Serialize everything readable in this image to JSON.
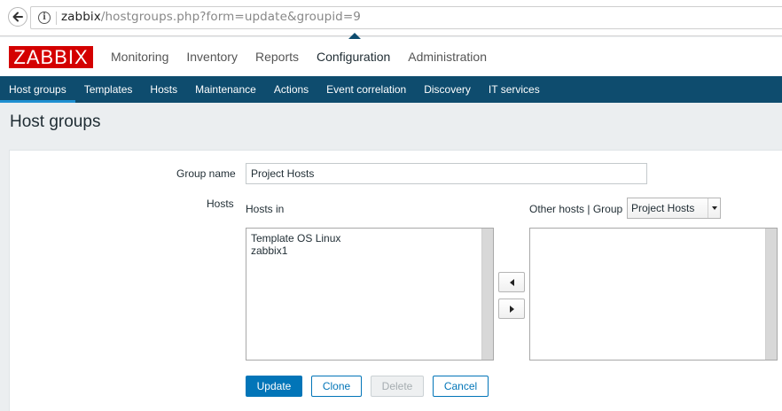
{
  "browser": {
    "url_host": "zabbix",
    "url_path": "/hostgroups.php?form=update&groupid=9"
  },
  "header": {
    "logo": "ZABBIX",
    "nav": [
      "Monitoring",
      "Inventory",
      "Reports",
      "Configuration",
      "Administration"
    ],
    "active_nav": "Configuration"
  },
  "subnav": {
    "items": [
      "Host groups",
      "Templates",
      "Hosts",
      "Maintenance",
      "Actions",
      "Event correlation",
      "Discovery",
      "IT services"
    ],
    "active": "Host groups"
  },
  "page": {
    "title": "Host groups"
  },
  "form": {
    "group_name_label": "Group name",
    "group_name_value": "Project Hosts",
    "hosts_label": "Hosts",
    "hosts_in_label": "Hosts in",
    "other_hosts_label": "Other hosts | Group",
    "group_select_value": "Project Hosts",
    "hosts_in": [
      "Template OS Linux",
      "zabbix1"
    ],
    "other_hosts": [],
    "buttons": {
      "update": "Update",
      "clone": "Clone",
      "delete": "Delete",
      "cancel": "Cancel"
    }
  },
  "colors": {
    "brand_red": "#d40000",
    "subnav_bg": "#0e4c6e",
    "primary": "#0275b8"
  }
}
